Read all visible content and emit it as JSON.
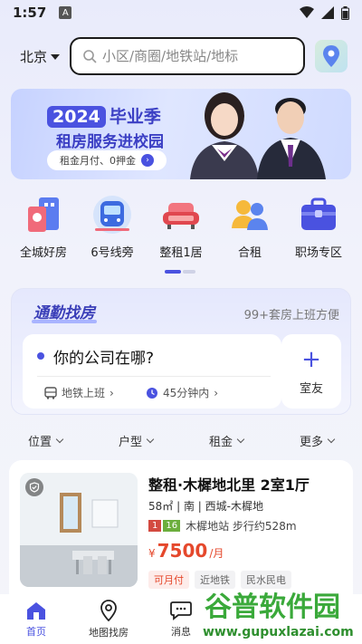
{
  "status_bar": {
    "time": "1:57",
    "badge": "A"
  },
  "header": {
    "city": "北京",
    "search_placeholder": "小区/商圈/地铁站/地标"
  },
  "banner": {
    "year": "2024",
    "headline": "毕业季",
    "subheadline": "租房服务进校园",
    "pill_text": "租金月付、0押金"
  },
  "categories": [
    {
      "label": "全城好房",
      "icon": "city-building-icon"
    },
    {
      "label": "6号线旁",
      "icon": "metro-train-icon"
    },
    {
      "label": "整租1居",
      "icon": "sofa-icon"
    },
    {
      "label": "合租",
      "icon": "people-icon"
    },
    {
      "label": "职场专区",
      "icon": "briefcase-icon"
    }
  ],
  "commute": {
    "title": "通勤找房",
    "count_text": "99+套房上班方便",
    "question": "你的公司在哪?",
    "mode": "地铁上班",
    "duration": "45分钟内",
    "roommate_label": "室友"
  },
  "filters": [
    "位置",
    "户型",
    "租金",
    "更多"
  ],
  "listing": {
    "title": "整租·木樨地北里 2室1厅",
    "meta": "58㎡ | 南 | 西城-木樨地",
    "line_a": "1",
    "line_b": "16",
    "metro_text": "木樨地站 步行约528m",
    "price_prefix": "¥",
    "price": "7500",
    "price_unit": "/月",
    "tags": [
      "可月付",
      "近地铁",
      "民水民电"
    ]
  },
  "tabs": [
    {
      "label": "首页",
      "active": true
    },
    {
      "label": "地图找房",
      "active": false
    },
    {
      "label": "消息",
      "active": false
    },
    {
      "label": "",
      "active": false
    },
    {
      "label": "",
      "active": false
    }
  ],
  "watermark": {
    "main": "谷普软件园",
    "url": "www.gupuxlazai.com"
  },
  "colors": {
    "accent": "#4a52e0",
    "price": "#e5482c"
  }
}
